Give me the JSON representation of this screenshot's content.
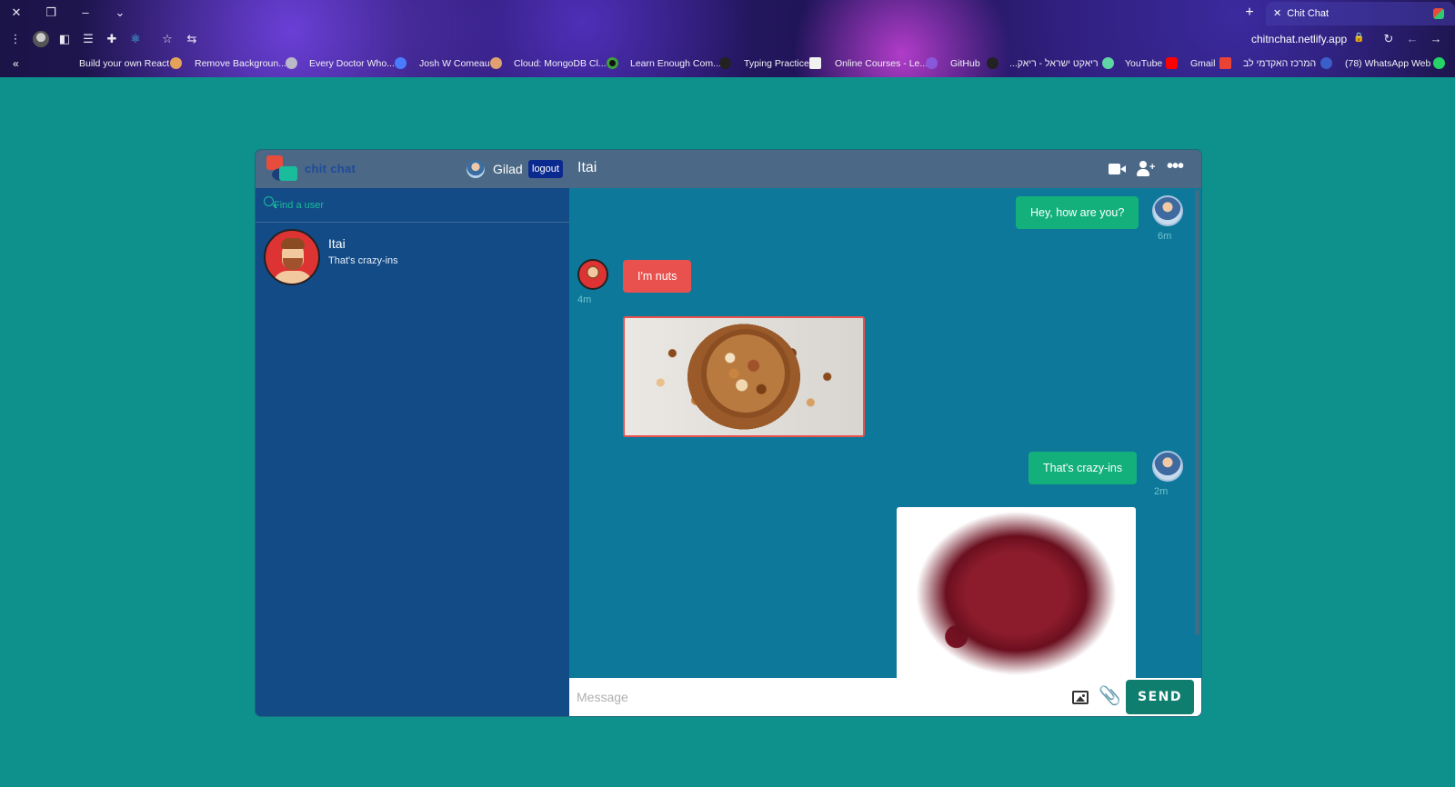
{
  "browser": {
    "tab_title": "Chit Chat",
    "url": "chitnchat.netlify.app",
    "bookmarks": [
      "Build your own React",
      "Remove Backgroun...",
      "Every Doctor Who...",
      "Josh W Comeau",
      "Cloud: MongoDB Cl...",
      "Learn Enough Com...",
      "Typing Practice",
      "Online Courses - Le...",
      "GitHub",
      "...ריאקט ישראל - ריאק",
      "YouTube",
      "Gmail",
      "המרכז האקדמי לב",
      "(78) WhatsApp Web"
    ]
  },
  "app": {
    "brand": "chit chat",
    "current_user": "Gilad",
    "logout_label": "logout",
    "search_placeholder": "Find a user",
    "contacts": [
      {
        "name": "Itai",
        "last_message": "That's crazy-ins"
      }
    ],
    "chat": {
      "title": "Itai",
      "messages": [
        {
          "type": "text",
          "from": "me",
          "text": "Hey, how are you?",
          "time": "6m"
        },
        {
          "type": "text",
          "from": "them",
          "text": "I'm nuts",
          "time": "4m"
        },
        {
          "type": "image",
          "from": "them",
          "subject": "mixed nuts in wooden bowl"
        },
        {
          "type": "text",
          "from": "me",
          "text": "That's crazy-ins",
          "time": "2m"
        },
        {
          "type": "image",
          "from": "me",
          "subject": "dried cranberries"
        }
      ]
    },
    "composer": {
      "placeholder": "Message",
      "send_label": "SEND"
    }
  }
}
